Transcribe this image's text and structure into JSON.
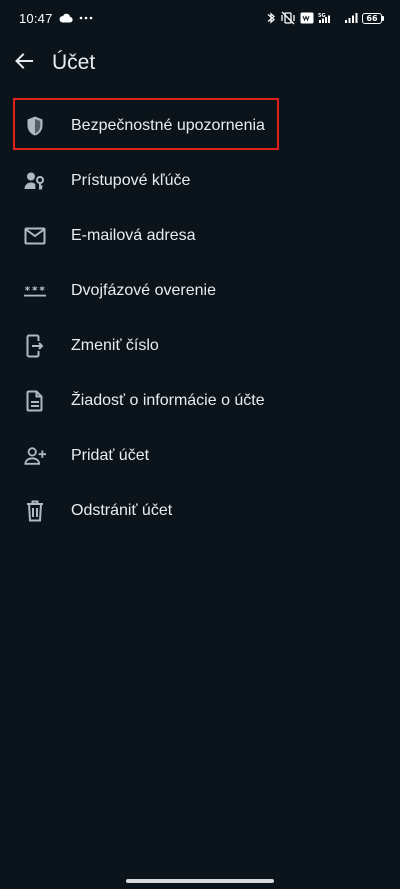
{
  "status_bar": {
    "time": "10:47",
    "battery": "66",
    "network": "5G"
  },
  "header": {
    "title": "Účet",
    "back_icon": "arrow-left-icon"
  },
  "menu": {
    "items": [
      {
        "label": "Bezpečnostné upozornenia",
        "icon": "shield-icon"
      },
      {
        "label": "Prístupové kľúče",
        "icon": "passkey-icon"
      },
      {
        "label": "E-mailová adresa",
        "icon": "mail-icon"
      },
      {
        "label": "Dvojfázové overenie",
        "icon": "password-dots-icon"
      },
      {
        "label": "Zmeniť číslo",
        "icon": "phone-change-icon"
      },
      {
        "label": "Žiadosť o informácie o účte",
        "icon": "document-icon"
      },
      {
        "label": "Pridať účet",
        "icon": "add-person-icon"
      },
      {
        "label": "Odstrániť účet",
        "icon": "trash-icon"
      }
    ]
  },
  "colors": {
    "background": "#0b141a",
    "text": "#e9edef",
    "icon": "#aebac1",
    "highlight_border": "#e0201b"
  }
}
